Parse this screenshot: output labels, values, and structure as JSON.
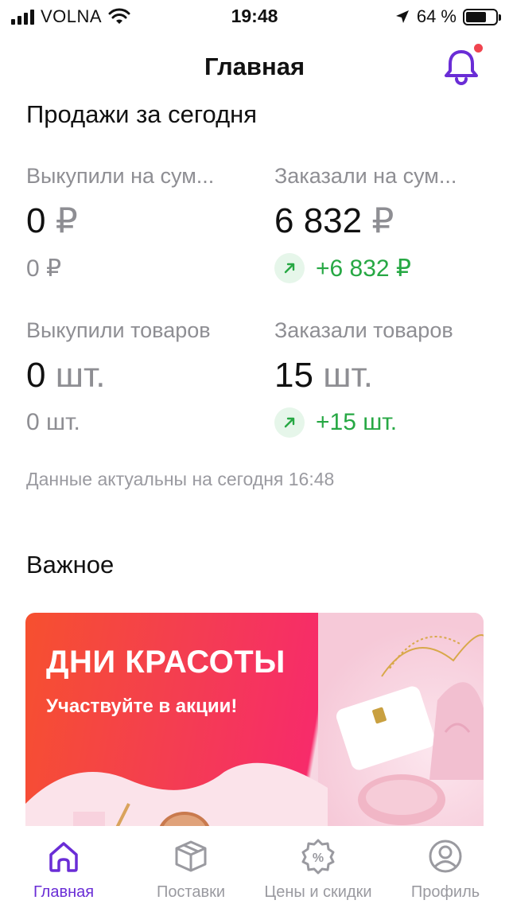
{
  "status_bar": {
    "carrier": "VOLNA",
    "time": "19:48",
    "battery_percent": "64 %"
  },
  "header": {
    "title": "Главная",
    "notification_dot": true
  },
  "sales_today": {
    "title": "Продажи за сегодня",
    "bought_sum": {
      "label": "Выкупили на сум...",
      "value": "0",
      "unit": "₽",
      "sub": "0 ₽"
    },
    "ordered_sum": {
      "label": "Заказали на сум...",
      "value": "6 832",
      "unit": "₽",
      "delta": "+6 832 ₽"
    },
    "bought_items": {
      "label": "Выкупили товаров",
      "value": "0",
      "unit": "шт.",
      "sub": "0 шт."
    },
    "ordered_items": {
      "label": "Заказали товаров",
      "value": "15",
      "unit": "шт.",
      "delta": "+15 шт."
    },
    "updated_note": "Данные актуальны на сегодня 16:48"
  },
  "important": {
    "title": "Важное",
    "banner": {
      "title": "ДНИ КРАСОТЫ",
      "subtitle": "Участвуйте в акции!"
    }
  },
  "tab_bar": {
    "tabs": [
      {
        "label": "Главная",
        "icon": "home-icon",
        "active": true
      },
      {
        "label": "Поставки",
        "icon": "box-icon",
        "active": false
      },
      {
        "label": "Цены и скидки",
        "icon": "discount-badge-icon",
        "active": false
      },
      {
        "label": "Профиль",
        "icon": "profile-icon",
        "active": false
      }
    ]
  },
  "colors": {
    "accent": "#6a2dd6",
    "positive": "#27a844",
    "muted": "#8e8e93",
    "notification": "#f0444f"
  }
}
